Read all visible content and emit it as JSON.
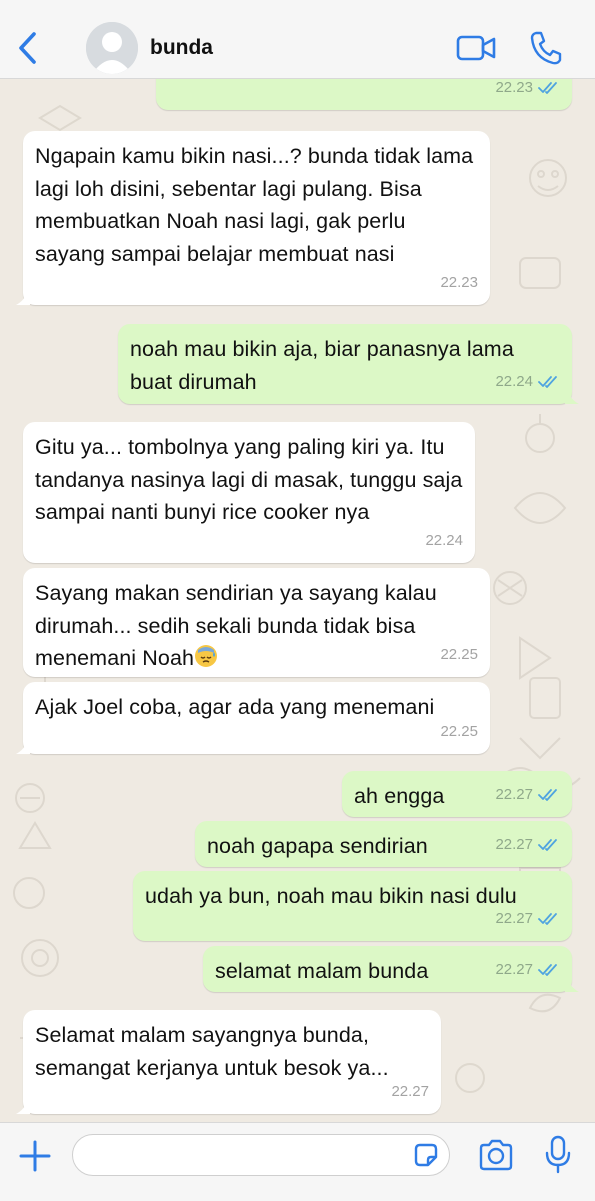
{
  "header": {
    "back_icon": "chevron-left-icon",
    "contact_name": "bunda",
    "video_icon": "video-camera-icon",
    "call_icon": "phone-icon",
    "accent_color": "#2f7ce5"
  },
  "messages": [
    {
      "direction": "out",
      "text": "",
      "time": "22.23",
      "read": true
    },
    {
      "direction": "in",
      "text": "Ngapain kamu bikin nasi...? bunda tidak lama lagi loh disini, sebentar lagi pulang. Bisa membuatkan Noah nasi lagi, gak perlu sayang sampai belajar membuat nasi",
      "time": "22.23"
    },
    {
      "direction": "out",
      "text": "noah mau bikin aja, biar panasnya lama buat dirumah",
      "time": "22.24",
      "read": true
    },
    {
      "direction": "in",
      "text": "Gitu ya... tombolnya yang paling kiri ya. Itu tandanya nasinya lagi di masak, tunggu saja sampai nanti bunyi rice cooker nya",
      "time": "22.24"
    },
    {
      "direction": "in",
      "text": "Sayang makan sendirian ya sayang kalau dirumah... sedih sekali bunda tidak bisa menemani Noah",
      "emoji": "downcast-face-with-sweat-emoji",
      "time": "22.25"
    },
    {
      "direction": "in",
      "text": "Ajak Joel coba, agar ada yang menemani",
      "time": "22.25"
    },
    {
      "direction": "out",
      "text": "ah engga",
      "time": "22.27",
      "read": true
    },
    {
      "direction": "out",
      "text": "noah gapapa sendirian",
      "time": "22.27",
      "read": true
    },
    {
      "direction": "out",
      "text": "udah ya bun, noah mau bikin nasi dulu",
      "time": "22.27",
      "read": true
    },
    {
      "direction": "out",
      "text": "selamat malam bunda",
      "time": "22.27",
      "read": true
    },
    {
      "direction": "in",
      "text": "Selamat malam sayangnya bunda, semangat kerjanya untuk besok ya...",
      "time": "22.27"
    }
  ],
  "colors": {
    "incoming_bubble": "#ffffff",
    "outgoing_bubble": "#dcf8c6",
    "read_ticks": "#4fa3e0",
    "chat_background": "#efeae2"
  },
  "input_bar": {
    "plus_icon": "plus-icon",
    "message_value": "",
    "sticker_icon": "sticker-icon",
    "camera_icon": "camera-icon",
    "mic_icon": "microphone-icon"
  }
}
